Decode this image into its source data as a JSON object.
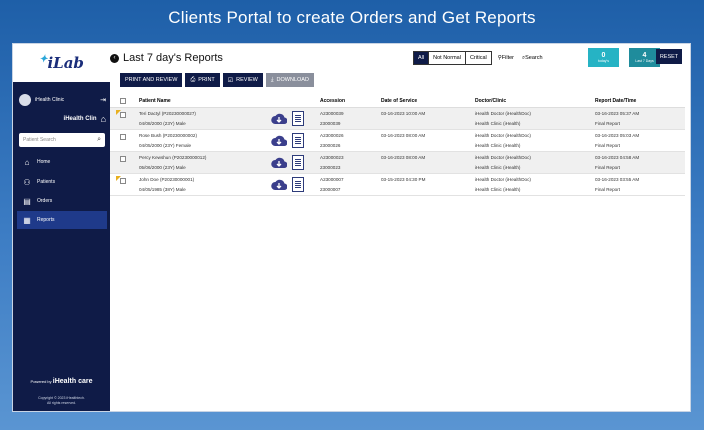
{
  "banner": "Clients Portal to create Orders and Get Reports",
  "sidebar": {
    "logo": "iLab",
    "clinic_user": "iHealth Clinic",
    "clinic_name": "iHealth Clin",
    "search_placeholder": "Patient Search",
    "nav": [
      {
        "label": "Home",
        "icon": "home-icon"
      },
      {
        "label": "Patients",
        "icon": "patients-icon"
      },
      {
        "label": "Orders",
        "icon": "orders-icon"
      },
      {
        "label": "Reports",
        "icon": "reports-icon",
        "active": true
      }
    ],
    "powered_by": "Powered by",
    "brand": "iHealth care",
    "copyright_line1": "Copyright © 2023 iHealthtech.",
    "copyright_line2": "All rights reserved."
  },
  "header": {
    "title": "Last 7 day's Reports",
    "segments": [
      "All",
      "Not Normal",
      "Critical"
    ],
    "active_segment": "All",
    "filter_label": "Filter",
    "search_label": "Search",
    "stats": [
      {
        "value": "0",
        "label": "today's",
        "color": "#26b3c4"
      },
      {
        "value": "4",
        "label": "Last 7 Days",
        "color": "#1f8c9c"
      }
    ],
    "reset_label": "RESET"
  },
  "actions": {
    "print_review": "PRINT AND REVIEW",
    "print": "PRINT",
    "review": "REVIEW",
    "download": "DOWNLOAD"
  },
  "table": {
    "columns": [
      "Patient Name",
      "Accession",
      "Date of Service",
      "Doctor/Clinic",
      "Report Date/Time"
    ],
    "rows": [
      {
        "name": "Teri Dactyl (P20230000027)",
        "dob": "04/08/2000 (23Y) Male",
        "accession": "A23000039",
        "accession2": "23000039",
        "service": "03-16-2023 10:00 AM",
        "doctor": "iHealth Doctor (iHealthDoc)",
        "clinic": "iHealth Clinic (iHealth)",
        "report_date": "03-16-2023 05:37 AM",
        "report_status": "Final Report",
        "flag": true
      },
      {
        "name": "Rose Bush (P20230000002)",
        "dob": "04/05/2000 (23Y) Female",
        "accession": "A23000026",
        "accession2": "23000026",
        "service": "03-16-2023 08:00 AM",
        "doctor": "iHealth Doctor (iHealthDoc)",
        "clinic": "iHealth Clinic (iHealth)",
        "report_date": "03-16-2023 05:03 AM",
        "report_status": "Final Report",
        "flag": false
      },
      {
        "name": "Percy Kewshun (P20230000012)",
        "dob": "05/06/2000 (23Y) Male",
        "accession": "A23000023",
        "accession2": "23000023",
        "service": "03-16-2023 08:00 AM",
        "doctor": "iHealth Doctor (iHealthDoc)",
        "clinic": "iHealth Clinic (iHealth)",
        "report_date": "03-16-2023 04:58 AM",
        "report_status": "Final Report",
        "flag": false
      },
      {
        "name": "John Doe (P20230000001)",
        "dob": "04/05/1985 (38Y) Male",
        "accession": "A23000007",
        "accession2": "23000007",
        "service": "03-15-2023 04:30 PM",
        "doctor": "iHealth Doctor (iHealthDoc)",
        "clinic": "iHealth Clinic (iHealth)",
        "report_date": "03-16-2023 03:55 AM",
        "report_status": "Final Report",
        "flag": true
      }
    ]
  },
  "colors": {
    "navy": "#0f1b47",
    "accent_flag": "#e8b020",
    "active_nav": "#1f3a8a"
  }
}
